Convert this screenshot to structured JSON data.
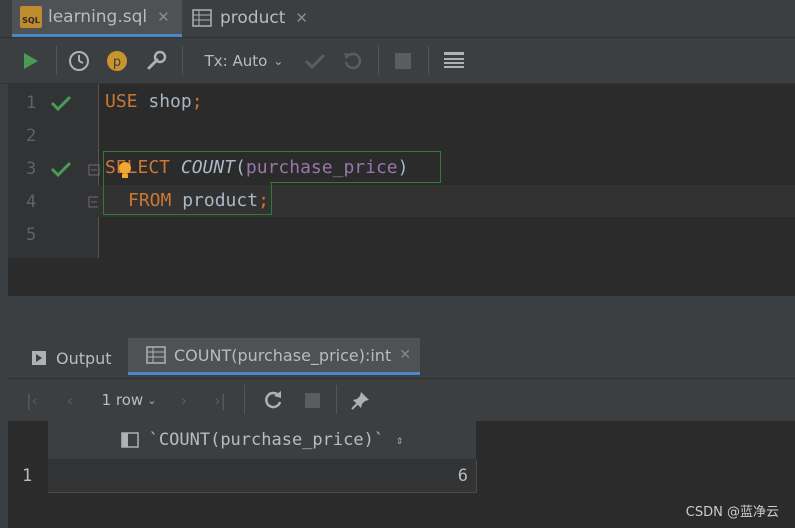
{
  "editor_tabs": [
    {
      "label": "learning.sql",
      "close": "✕"
    },
    {
      "label": "product",
      "close": "✕"
    }
  ],
  "toolbar": {
    "tx_mode": "Tx: Auto"
  },
  "editor": {
    "line_numbers": [
      "1",
      "2",
      "3",
      "4",
      "5"
    ],
    "lines": {
      "l1_kw": "USE",
      "l1_id": " shop",
      "l1_pun": ";",
      "l3_kw": "SELECT",
      "l3_fn": " COUNT",
      "l3_p1": "(",
      "l3_col": "purchase_price",
      "l3_p2": ")",
      "l4_kw": "FROM",
      "l4_id": " product",
      "l4_pun": ";"
    }
  },
  "results": {
    "tabs": [
      {
        "label": "Output"
      },
      {
        "label": "COUNT(purchase_price):int",
        "close": "✕"
      }
    ],
    "row_count": "1 row",
    "column_header": "`COUNT(purchase_price)`",
    "rows": [
      {
        "num": "1",
        "value": "6"
      }
    ]
  },
  "watermark": "CSDN @蓝净云",
  "colors": {
    "accent": "#4a88c7",
    "run_green": "#499c54",
    "keyword": "#cc7832",
    "column": "#9876aa"
  }
}
